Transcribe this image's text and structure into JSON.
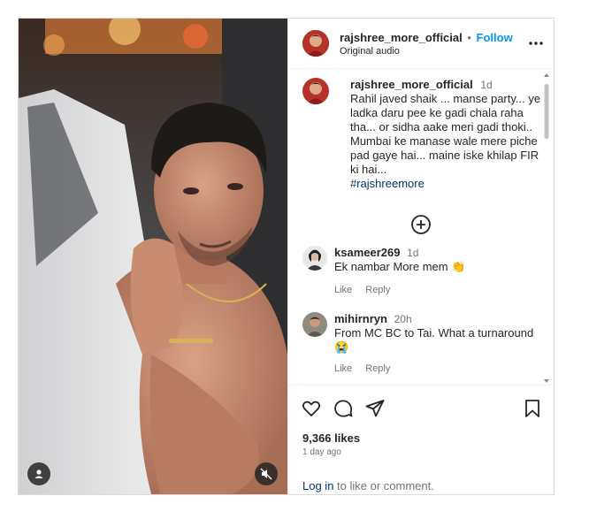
{
  "post": {
    "author": "rajshree_more_official",
    "follow_label": "Follow",
    "dot": "•",
    "audio": "Original audio",
    "more_icon": "more-horizontal-icon"
  },
  "caption": {
    "username": "rajshree_more_official",
    "time": "1d",
    "text": "Rahil javed  shaik ... manse party... ye ladka daru pee ke gadi chala raha tha... or sidha aake meri gadi thoki.. Mumbai ke manase wale mere piche pad gaye hai...⁣⁣ maine iske khilap FIR ki hai...",
    "hashtag": "#rajshreemore"
  },
  "comments": [
    {
      "username": "ksameer269",
      "time": "1d",
      "text": "Ek nambar More mem 👏",
      "like_label": "Like",
      "reply_label": "Reply"
    },
    {
      "username": "mihirnryn",
      "time": "20h",
      "text": "From MC BC to Tai. What a turnaround 😭",
      "like_label": "Like",
      "reply_label": "Reply"
    }
  ],
  "load_more_icon": "plus-circle-icon",
  "stats": {
    "likes": "9,366 likes",
    "ago": "1 day ago"
  },
  "login": {
    "link": "Log in",
    "rest": " to like or comment."
  },
  "colors": {
    "accent": "#0095f6",
    "text": "#262626",
    "muted": "#737373",
    "border": "#dbdbdb"
  }
}
